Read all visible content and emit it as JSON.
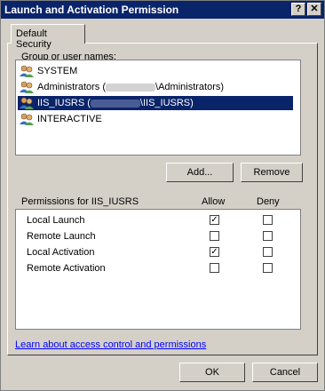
{
  "window": {
    "title": "Launch and Activation Permission",
    "help_glyph": "?",
    "close_glyph": "✕"
  },
  "tabs": [
    {
      "label": "Default Security"
    }
  ],
  "groups": {
    "label": "Group or user names:",
    "items": [
      {
        "name": "SYSTEM",
        "icon": "user-group-icon",
        "selected": false,
        "pre": "",
        "post": ""
      },
      {
        "name": "Administrators (",
        "icon": "user-group-icon",
        "selected": false,
        "pre": "",
        "post": "\\Administrators)"
      },
      {
        "name": "IIS_IUSRS (",
        "icon": "user-group-icon",
        "selected": true,
        "pre": "",
        "post": "\\IIS_IUSRS)"
      },
      {
        "name": "INTERACTIVE",
        "icon": "user-group-icon",
        "selected": false,
        "pre": "",
        "post": ""
      }
    ]
  },
  "buttons": {
    "add": "Add...",
    "remove": "Remove",
    "ok": "OK",
    "cancel": "Cancel"
  },
  "permissions": {
    "label": "Permissions for IIS_IUSRS",
    "allow_header": "Allow",
    "deny_header": "Deny",
    "rows": [
      {
        "name": "Local Launch",
        "allow": true,
        "deny": false
      },
      {
        "name": "Remote Launch",
        "allow": false,
        "deny": false
      },
      {
        "name": "Local Activation",
        "allow": true,
        "deny": false
      },
      {
        "name": "Remote Activation",
        "allow": false,
        "deny": false
      }
    ]
  },
  "link": {
    "text": "Learn about access control and permissions"
  },
  "colors": {
    "titlebar": "#0a246a",
    "selection": "#0a246a",
    "link": "#0000ff"
  }
}
